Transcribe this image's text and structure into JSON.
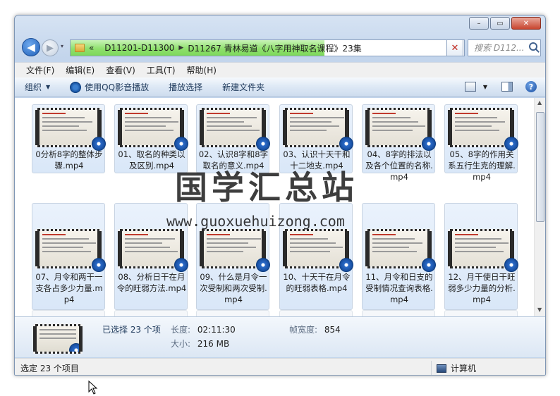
{
  "window": {
    "caption_buttons": [
      "–",
      "▭",
      "✕"
    ]
  },
  "nav": {
    "back_glyph": "◀",
    "forward_glyph": "▶",
    "dropdown_glyph": "▾",
    "breadcrumbs": [
      "«",
      "D11201-D11300",
      "D11267 青林易道《八字用神取名课程》23集"
    ],
    "stop_glyph": "✕",
    "search_placeholder": "搜索 D112..."
  },
  "menubar": [
    "文件(F)",
    "编辑(E)",
    "查看(V)",
    "工具(T)",
    "帮助(H)"
  ],
  "cmdbar": {
    "organize": "组织",
    "play_qq": "使用QQ影音播放",
    "play_selection": "播放选择",
    "new_folder": "新建文件夹",
    "help_glyph": "?"
  },
  "files": [
    {
      "name": "0分析8字的整体步骤.mp4"
    },
    {
      "name": "01、取名的种类以及区别.mp4"
    },
    {
      "name": "02、认识8字和8字取名的意义.mp4"
    },
    {
      "name": "03、认识十天干和十二地支.mp4"
    },
    {
      "name": "04、8字的排法以及各个位置的名称.mp4"
    },
    {
      "name": "05、8字的作用关系五行生克的理解.mp4"
    },
    {
      "name": "07、月令和两干一支各占多少力量.mp4"
    },
    {
      "name": "08、分析日干在月令的旺弱方法.mp4"
    },
    {
      "name": "09、什么是月令一次受制和两次受制.mp4"
    },
    {
      "name": "10、十天干在月令的旺弱表格.mp4"
    },
    {
      "name": "11、月令和日支的受制情况查询表格.mp4"
    },
    {
      "name": "12、月干使日干旺弱多少力量的分析.mp4"
    }
  ],
  "watermark": {
    "main": "国学汇总站",
    "sub": "www.guoxuehuizong.com"
  },
  "details": {
    "selected": "已选择 23 个项",
    "length_key": "长度:",
    "length_value": "02:11:30",
    "framewidth_key": "帧宽度:",
    "framewidth_value": "854",
    "size_key": "大小:",
    "size_value": "216 MB"
  },
  "statusbar": {
    "left": "选定 23 个项目",
    "right": "计算机"
  }
}
